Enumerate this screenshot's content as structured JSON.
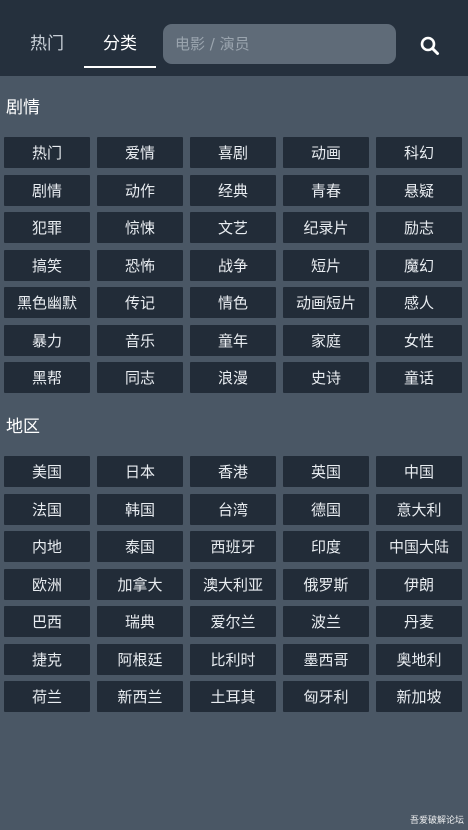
{
  "header": {
    "tabs": [
      "热门",
      "分类"
    ],
    "active_tab": "分类",
    "search": {
      "placeholder": "电影 / 演员",
      "value": ""
    },
    "search_icon": "search-icon"
  },
  "sections": [
    {
      "title": "剧情",
      "tags": [
        "热门",
        "爱情",
        "喜剧",
        "动画",
        "科幻",
        "剧情",
        "动作",
        "经典",
        "青春",
        "悬疑",
        "犯罪",
        "惊悚",
        "文艺",
        "纪录片",
        "励志",
        "搞笑",
        "恐怖",
        "战争",
        "短片",
        "魔幻",
        "黑色幽默",
        "传记",
        "情色",
        "动画短片",
        "感人",
        "暴力",
        "音乐",
        "童年",
        "家庭",
        "女性",
        "黑帮",
        "同志",
        "浪漫",
        "史诗",
        "童话"
      ]
    },
    {
      "title": "地区",
      "tags": [
        "美国",
        "日本",
        "香港",
        "英国",
        "中国",
        "法国",
        "韩国",
        "台湾",
        "德国",
        "意大利",
        "内地",
        "泰国",
        "西班牙",
        "印度",
        "中国大陆",
        "欧洲",
        "加拿大",
        "澳大利亚",
        "俄罗斯",
        "伊朗",
        "巴西",
        "瑞典",
        "爱尔兰",
        "波兰",
        "丹麦",
        "捷克",
        "阿根廷",
        "比利时",
        "墨西哥",
        "奥地利",
        "荷兰",
        "新西兰",
        "土耳其",
        "匈牙利",
        "新加坡"
      ]
    }
  ],
  "watermark": "吾爱破解论坛",
  "colors": {
    "header_bg": "#25303d",
    "page_bg": "#4a5765",
    "tag_bg": "#222c38",
    "search_bg": "#5f6b78"
  }
}
